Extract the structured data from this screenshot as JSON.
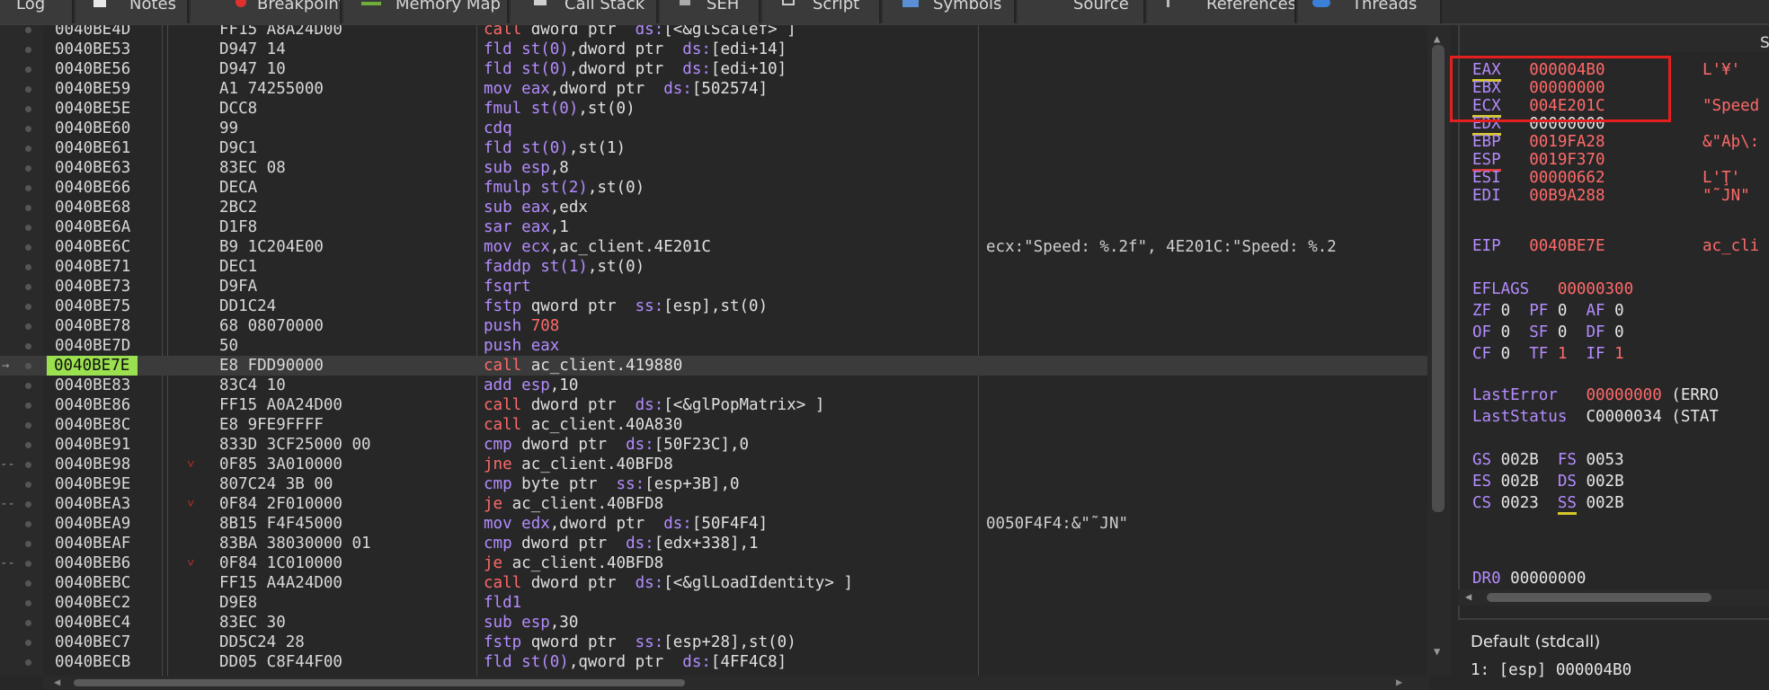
{
  "tabs": [
    {
      "label": "Log",
      "icon": "log-icon"
    },
    {
      "label": "Notes",
      "icon": "notes-icon"
    },
    {
      "label": "Breakpoints",
      "icon": "breakpoint-icon"
    },
    {
      "label": "Memory Map",
      "icon": "memory-map-icon"
    },
    {
      "label": "Call Stack",
      "icon": "call-stack-icon"
    },
    {
      "label": "SEH",
      "icon": "seh-icon"
    },
    {
      "label": "Script",
      "icon": "script-icon"
    },
    {
      "label": "Symbols",
      "icon": "symbols-icon"
    },
    {
      "label": "Source",
      "icon": "source-icon"
    },
    {
      "label": "References",
      "icon": "references-icon"
    },
    {
      "label": "Threads",
      "icon": "threads-icon"
    }
  ],
  "disasm": [
    {
      "addr": "0040BE4D",
      "bytes": "FF15 A8A24D00",
      "mn": "call",
      "ops": " dword ptr  ds:[<&glScalef> ]",
      "cls": "kw-call",
      "cmt": ""
    },
    {
      "addr": "0040BE53",
      "bytes": "D947 14",
      "mn": "fld",
      "ops": " st(0),dword ptr  ds:[edi+14]",
      "cls": "kw-fpu",
      "cmt": ""
    },
    {
      "addr": "0040BE56",
      "bytes": "D947 10",
      "mn": "fld",
      "ops": " st(0),dword ptr  ds:[edi+10]",
      "cls": "kw-fpu",
      "cmt": ""
    },
    {
      "addr": "0040BE59",
      "bytes": "A1 74255000",
      "mn": "mov",
      "ops": " eax,dword ptr  ds:[502574]",
      "cls": "kw-mov",
      "cmt": ""
    },
    {
      "addr": "0040BE5E",
      "bytes": "DCC8",
      "mn": "fmul",
      "ops": " st(0),st(0)",
      "cls": "kw-fpu",
      "cmt": ""
    },
    {
      "addr": "0040BE60",
      "bytes": "99",
      "mn": "cdq",
      "ops": "",
      "cls": "kw-fpu",
      "cmt": ""
    },
    {
      "addr": "0040BE61",
      "bytes": "D9C1",
      "mn": "fld",
      "ops": " st(0),st(1)",
      "cls": "kw-fpu",
      "cmt": ""
    },
    {
      "addr": "0040BE63",
      "bytes": "83EC 08",
      "mn": "sub",
      "ops": " esp,8",
      "cls": "kw-mov",
      "cmt": ""
    },
    {
      "addr": "0040BE66",
      "bytes": "DECA",
      "mn": "fmulp",
      "ops": " st(2),st(0)",
      "cls": "kw-fpu",
      "cmt": ""
    },
    {
      "addr": "0040BE68",
      "bytes": "2BC2",
      "mn": "sub",
      "ops": " eax,edx",
      "cls": "kw-mov",
      "cmt": ""
    },
    {
      "addr": "0040BE6A",
      "bytes": "D1F8",
      "mn": "sar",
      "ops": " eax,1",
      "cls": "kw-mov",
      "cmt": ""
    },
    {
      "addr": "0040BE6C",
      "bytes": "B9 1C204E00",
      "mn": "mov",
      "ops": " ecx,ac_client.4E201C",
      "cls": "kw-mov",
      "cmt": "ecx:\"Speed: %.2f\", 4E201C:\"Speed: %.2"
    },
    {
      "addr": "0040BE71",
      "bytes": "DEC1",
      "mn": "faddp",
      "ops": " st(1),st(0)",
      "cls": "kw-fpu",
      "cmt": ""
    },
    {
      "addr": "0040BE73",
      "bytes": "D9FA",
      "mn": "fsqrt",
      "ops": "",
      "cls": "kw-fpu",
      "cmt": ""
    },
    {
      "addr": "0040BE75",
      "bytes": "DD1C24",
      "mn": "fstp",
      "ops": " qword ptr  ss:[esp],st(0)",
      "cls": "kw-fpu",
      "cmt": ""
    },
    {
      "addr": "0040BE78",
      "bytes": "68 08070000",
      "mn": "push",
      "ops": " 708",
      "cls": "kw-stack",
      "cmt": ""
    },
    {
      "addr": "0040BE7D",
      "bytes": "50",
      "mn": "push",
      "ops": " eax",
      "cls": "kw-stack",
      "cmt": ""
    },
    {
      "addr": "0040BE7E",
      "bytes": "E8 FDD90000",
      "mn": "call",
      "ops": " ac_client.419880",
      "cls": "kw-call",
      "cmt": "",
      "current": true
    },
    {
      "addr": "0040BE83",
      "bytes": "83C4 10",
      "mn": "add",
      "ops": " esp,10",
      "cls": "kw-mov",
      "cmt": ""
    },
    {
      "addr": "0040BE86",
      "bytes": "FF15 A0A24D00",
      "mn": "call",
      "ops": " dword ptr  ds:[<&glPopMatrix> ]",
      "cls": "kw-call",
      "cmt": ""
    },
    {
      "addr": "0040BE8C",
      "bytes": "E8 9FE9FFFF",
      "mn": "call",
      "ops": " ac_client.40A830",
      "cls": "kw-call",
      "cmt": ""
    },
    {
      "addr": "0040BE91",
      "bytes": "833D 3CF25000 00",
      "mn": "cmp",
      "ops": " dword ptr  ds:[50F23C],0",
      "cls": "kw-mov",
      "cmt": ""
    },
    {
      "addr": "0040BE98",
      "bytes": "0F85 3A010000",
      "mn": "jne",
      "ops": " ac_client.40BFD8",
      "cls": "kw-jmp",
      "cmt": "",
      "jump": true
    },
    {
      "addr": "0040BE9E",
      "bytes": "807C24 3B 00",
      "mn": "cmp",
      "ops": " byte ptr  ss:[esp+3B],0",
      "cls": "kw-mov",
      "cmt": ""
    },
    {
      "addr": "0040BEA3",
      "bytes": "0F84 2F010000",
      "mn": "je",
      "ops": " ac_client.40BFD8",
      "cls": "kw-jmp",
      "cmt": "",
      "jump": true
    },
    {
      "addr": "0040BEA9",
      "bytes": "8B15 F4F45000",
      "mn": "mov",
      "ops": " edx,dword ptr  ds:[50F4F4]",
      "cls": "kw-mov",
      "cmt": "0050F4F4:&\"˜ЈN\""
    },
    {
      "addr": "0040BEAF",
      "bytes": "83BA 38030000 01",
      "mn": "cmp",
      "ops": " dword ptr  ds:[edx+338],1",
      "cls": "kw-mov",
      "cmt": ""
    },
    {
      "addr": "0040BEB6",
      "bytes": "0F84 1C010000",
      "mn": "je",
      "ops": " ac_client.40BFD8",
      "cls": "kw-jmp",
      "cmt": "",
      "jump": true
    },
    {
      "addr": "0040BEBC",
      "bytes": "FF15 A4A24D00",
      "mn": "call",
      "ops": " dword ptr  ds:[<&glLoadIdentity> ]",
      "cls": "kw-call",
      "cmt": ""
    },
    {
      "addr": "0040BEC2",
      "bytes": "D9E8",
      "mn": "fld1",
      "ops": "",
      "cls": "kw-fpu",
      "cmt": ""
    },
    {
      "addr": "0040BEC4",
      "bytes": "83EC 30",
      "mn": "sub",
      "ops": " esp,30",
      "cls": "kw-mov",
      "cmt": ""
    },
    {
      "addr": "0040BEC7",
      "bytes": "DD5C24 28",
      "mn": "fstp",
      "ops": " qword ptr  ss:[esp+28],st(0)",
      "cls": "kw-fpu",
      "cmt": ""
    },
    {
      "addr": "0040BECB",
      "bytes": "DD05 C8F44F00",
      "mn": "fld",
      "ops": " st(0),qword ptr  ds:[4FF4C8]",
      "cls": "kw-fpu",
      "cmt": ""
    }
  ],
  "registers_tab_label": "S",
  "registers": [
    {
      "name": "EAX",
      "value": "000004B0",
      "cmt": "L'¥'",
      "ul": "y"
    },
    {
      "name": "EBX",
      "value": "00000000",
      "cmt": "",
      "ul": ""
    },
    {
      "name": "ECX",
      "value": "004E201C",
      "cmt": "\"Speed",
      "ul": "y"
    },
    {
      "name": "EDX",
      "value": "00000000",
      "cmt": "",
      "ul": "y",
      "white": true
    },
    {
      "name": "EBP",
      "value": "0019FA28",
      "cmt": "&\"Aþ\\:",
      "ul": ""
    },
    {
      "name": "ESP",
      "value": "0019F370",
      "cmt": "",
      "ul": "r"
    },
    {
      "name": "ESI",
      "value": "00000662",
      "cmt": "L'Ţ'",
      "ul": ""
    },
    {
      "name": "EDI",
      "value": "00B9A288",
      "cmt": "\"˜ЈN\"",
      "ul": ""
    }
  ],
  "eip": {
    "name": "EIP",
    "value": "0040BE7E",
    "cmt": "ac_cli"
  },
  "eflags": {
    "name": "EFLAGS",
    "value": "00000300"
  },
  "flags": [
    [
      {
        "n": "ZF",
        "v": "0"
      },
      {
        "n": "PF",
        "v": "0"
      },
      {
        "n": "AF",
        "v": "0"
      }
    ],
    [
      {
        "n": "OF",
        "v": "0"
      },
      {
        "n": "SF",
        "v": "0"
      },
      {
        "n": "DF",
        "v": "0"
      }
    ],
    [
      {
        "n": "CF",
        "v": "0"
      },
      {
        "n": "TF",
        "v": "1"
      },
      {
        "n": "IF",
        "v": "1"
      }
    ]
  ],
  "last_error": {
    "name": "LastError",
    "value": "00000000",
    "cmt": "(ERRO"
  },
  "last_status": {
    "name": "LastStatus",
    "value": "C0000034",
    "cmt": "(STAT"
  },
  "segments": [
    [
      {
        "n": "GS",
        "v": "002B"
      },
      {
        "n": "FS",
        "v": "0053"
      }
    ],
    [
      {
        "n": "ES",
        "v": "002B"
      },
      {
        "n": "DS",
        "v": "002B"
      }
    ],
    [
      {
        "n": "CS",
        "v": "0023"
      },
      {
        "n": "SS",
        "v": "002B"
      }
    ]
  ],
  "dr0": {
    "name": "DR0",
    "value": "00000000"
  },
  "callstack": {
    "header": "Default (stdcall)",
    "line": "1: [esp] 000004B0"
  }
}
